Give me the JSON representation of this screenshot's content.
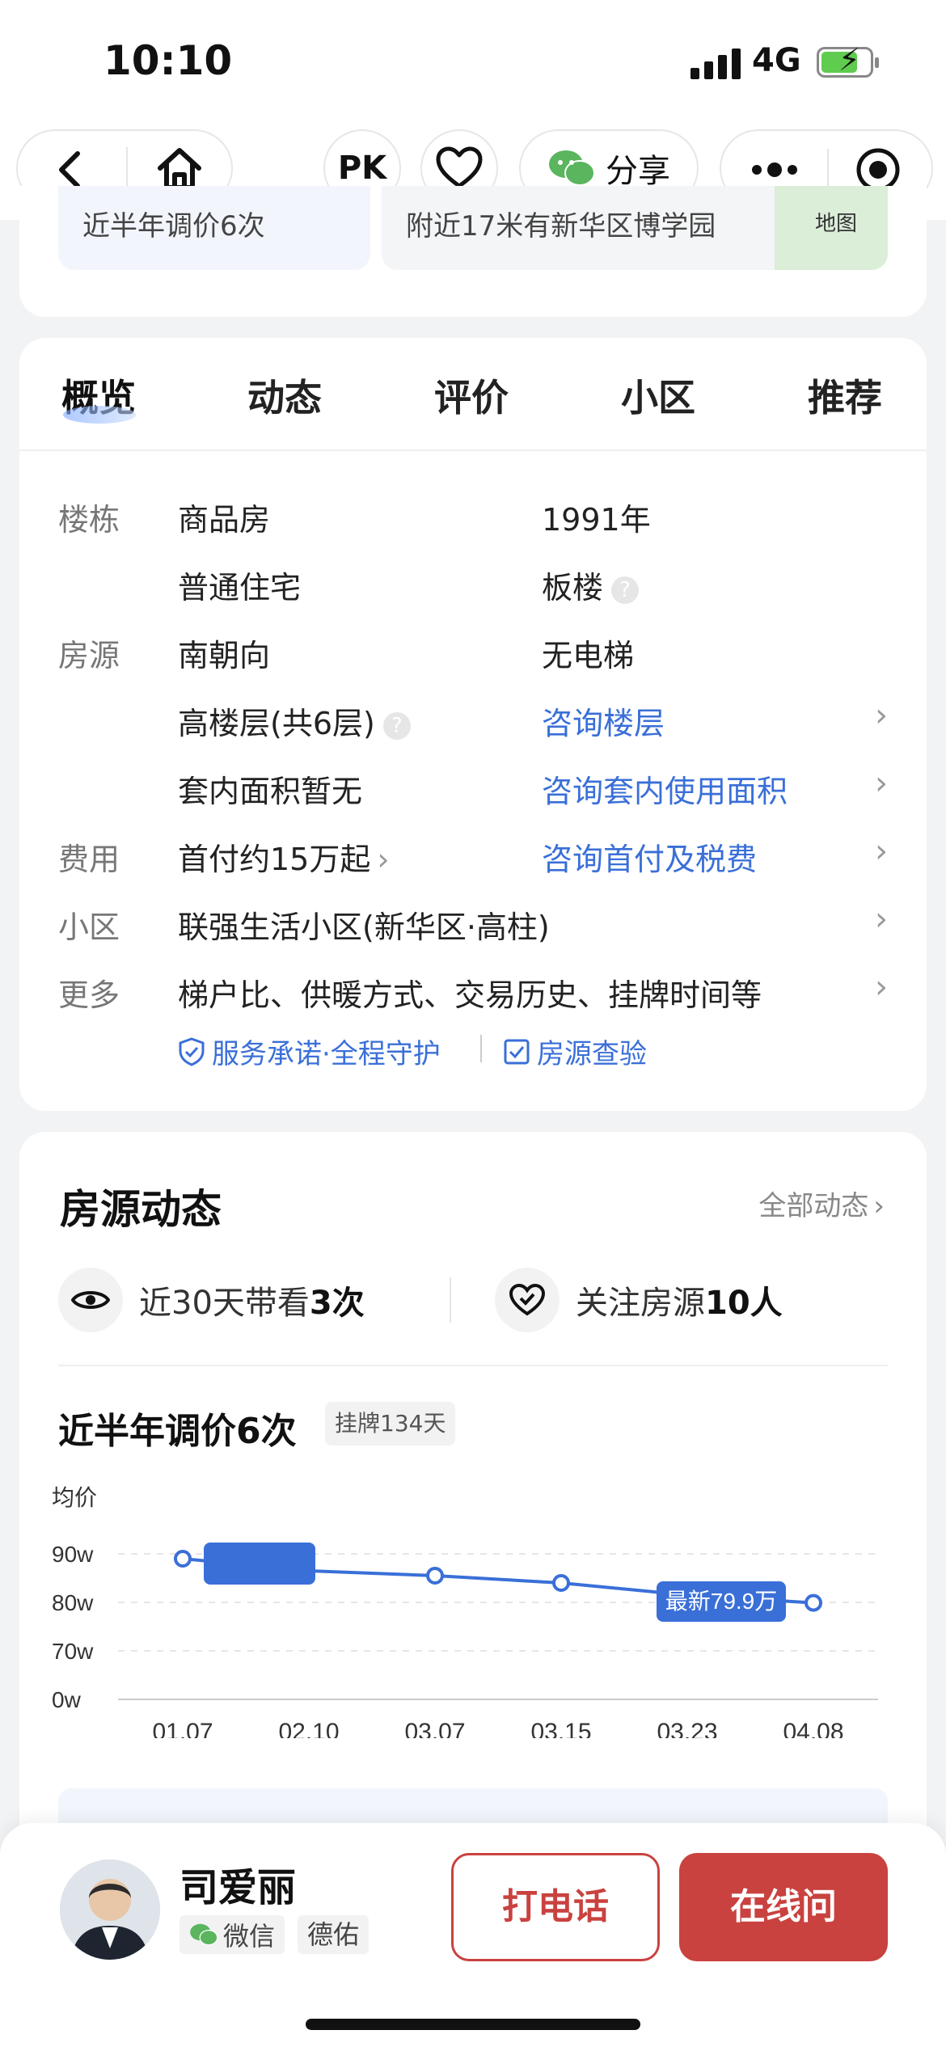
{
  "status": {
    "time": "10:10",
    "network": "4G"
  },
  "nav": {
    "pk": "PK",
    "share": "分享"
  },
  "top_snippet": {
    "left": "近半年调价6次",
    "right": "附近17米有新华区博学园",
    "map": "地图"
  },
  "tabs": [
    "概览",
    "动态",
    "评价",
    "小区",
    "推荐"
  ],
  "overview": {
    "building_label": "楼栋",
    "building_type": "商品房",
    "year": "1991年",
    "usage": "普通住宅",
    "structure": "板楼",
    "listing_label": "房源",
    "orientation": "南朝向",
    "elevator": "无电梯",
    "floor": "高楼层(共6层)",
    "floor_link": "咨询楼层",
    "inner_area": "套内面积暂无",
    "inner_area_link": "咨询套内使用面积",
    "fee_label": "费用",
    "down_payment": "首付约15万起",
    "fee_link": "咨询首付及税费",
    "community_label": "小区",
    "community": "联强生活小区(新华区·高柱)",
    "more_label": "更多",
    "more": "梯户比、供暖方式、交易历史、挂牌时间等",
    "service": "服务承诺·全程守护",
    "inspect": "房源查验"
  },
  "dynamics": {
    "title": "房源动态",
    "all_link": "全部动态",
    "views_prefix": "近30天带看",
    "views_count": "3次",
    "follow_prefix": "关注房源",
    "follow_count": "10人",
    "price_title": "近半年调价6次",
    "listing_days": "挂牌134天"
  },
  "chart_data": {
    "type": "line",
    "ylabel": "均价",
    "yticks": [
      "90w",
      "80w",
      "70w",
      "0w"
    ],
    "categories": [
      "01.07",
      "02.10",
      "03.07",
      "03.15",
      "03.23",
      "04.08"
    ],
    "values": [
      89,
      86.5,
      85.5,
      84,
      81.5,
      79.9
    ],
    "latest_label": "最新79.9万",
    "accent": "#3a6fd8"
  },
  "agent": {
    "name": "司爱丽",
    "wechat": "微信",
    "company": "德佑",
    "call": "打电话",
    "chat": "在线问"
  }
}
